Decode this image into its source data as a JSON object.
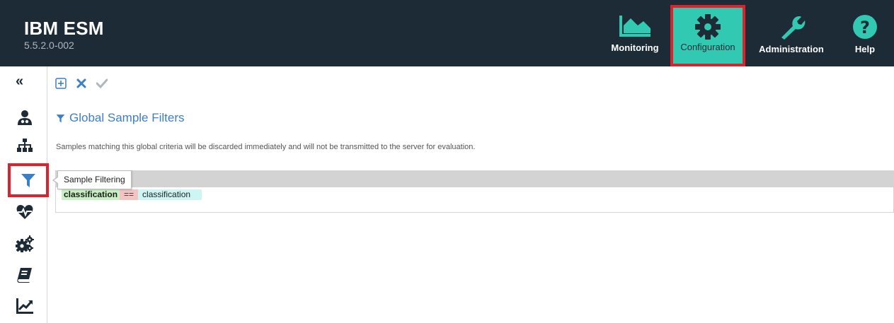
{
  "header": {
    "brand_title": "IBM ESM",
    "brand_version": "5.5.2.0-002",
    "nav": [
      {
        "label": "Monitoring",
        "icon": "area-chart-icon"
      },
      {
        "label": "Configuration",
        "icon": "gear-icon",
        "active": true
      },
      {
        "label": "Administration",
        "icon": "wrench-icon"
      },
      {
        "label": "Help",
        "icon": "help-circle-icon"
      }
    ]
  },
  "rail": {
    "collapse_glyph": "«",
    "items": [
      {
        "icon": "user-doctor-icon"
      },
      {
        "icon": "sitemap-icon"
      },
      {
        "icon": "filter-icon",
        "active": true,
        "tooltip": "Sample Filtering"
      },
      {
        "icon": "heartbeat-icon"
      },
      {
        "icon": "cogs-icon"
      },
      {
        "icon": "book-icon"
      },
      {
        "icon": "line-chart-icon"
      }
    ]
  },
  "toolbar": {
    "add_icon": "plus-square-icon",
    "discard_icon": "close-icon",
    "save_icon": "check-icon"
  },
  "main": {
    "title": "Global Sample Filters",
    "description": "Samples matching this global criteria will be discarded immediately and will not be transmitted to the server for evaluation.",
    "filter": {
      "field": "classification",
      "operator": "==",
      "value": "classification"
    }
  },
  "colors": {
    "header_bg": "#1d2b36",
    "accent": "#32c9b3",
    "highlight_border": "#e0202b",
    "link_blue": "#3c7ec7",
    "rail_icon": "#1d2b36",
    "filter_active": "#3c7ec7"
  }
}
